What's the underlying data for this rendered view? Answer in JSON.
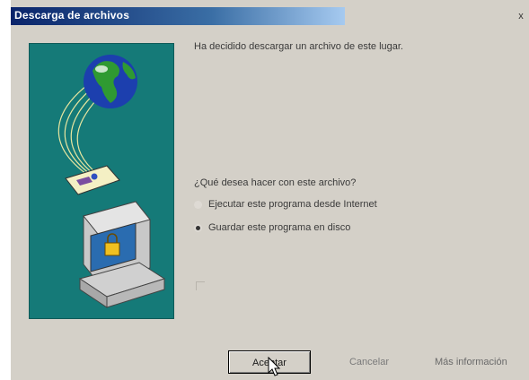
{
  "window": {
    "title": "Descarga de archivos",
    "close_glyph": "x"
  },
  "message": "Ha decidido descargar un archivo de este lugar.",
  "question": "¿Qué desea hacer con este archivo?",
  "options": [
    {
      "label": "Ejecutar este programa desde Internet",
      "checked": false
    },
    {
      "label": "Guardar este programa en disco",
      "checked": true
    }
  ],
  "checkbox": {
    "checked": false
  },
  "buttons": {
    "ok": "Aceptar",
    "cancel": "Cancelar",
    "more": "Más información"
  },
  "icons": {
    "illustration": "globe-download-computer-illustration",
    "cursor": "arrow-cursor-icon"
  },
  "colors": {
    "title_bar_start": "#0a246a",
    "title_bar_end": "#a6caf0",
    "illustration_bg": "#157a78",
    "dialog_bg": "#d4d0c8"
  }
}
